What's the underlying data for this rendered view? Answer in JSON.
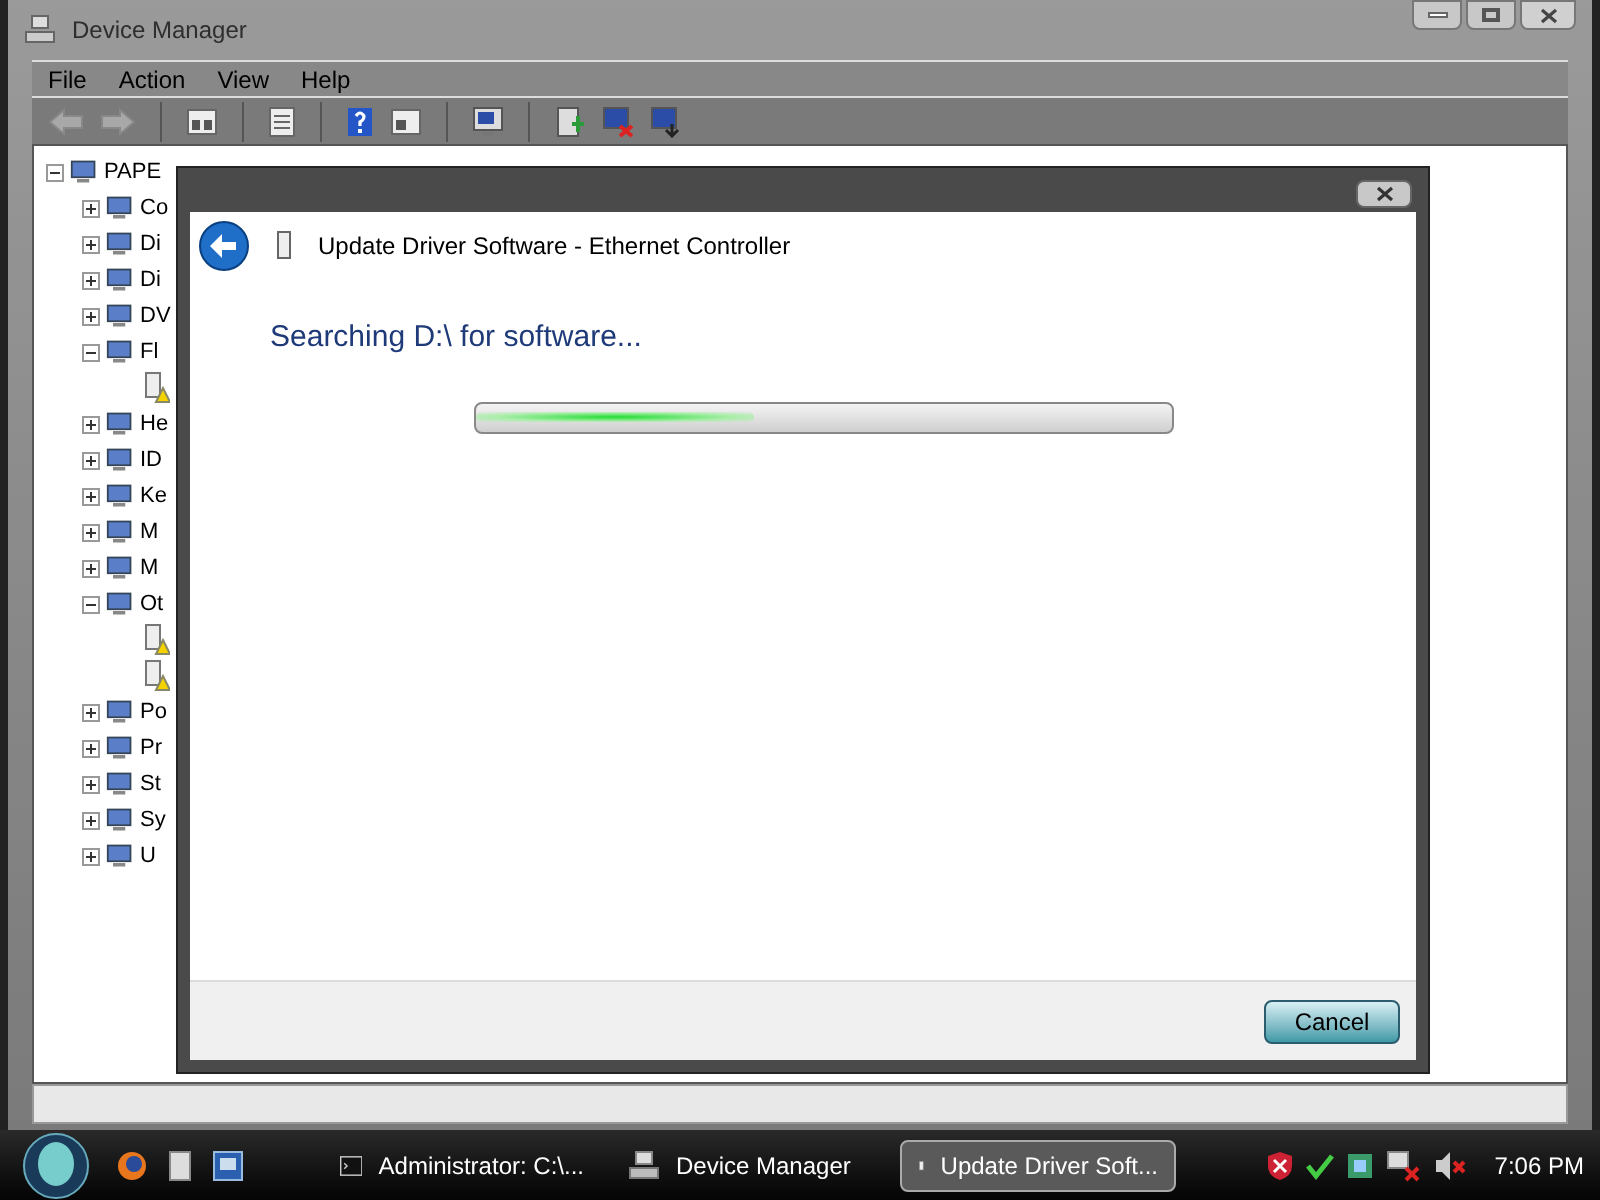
{
  "window": {
    "title": "Device Manager",
    "active": false
  },
  "menu": [
    "File",
    "Action",
    "View",
    "Help"
  ],
  "toolbar": [
    {
      "kind": "back"
    },
    {
      "kind": "forward"
    },
    {
      "kind": "sep"
    },
    {
      "kind": "console"
    },
    {
      "kind": "sep"
    },
    {
      "kind": "properties"
    },
    {
      "kind": "sep"
    },
    {
      "kind": "help"
    },
    {
      "kind": "view"
    },
    {
      "kind": "sep"
    },
    {
      "kind": "scan"
    },
    {
      "kind": "sep"
    },
    {
      "kind": "update"
    },
    {
      "kind": "disable"
    },
    {
      "kind": "uninstall"
    }
  ],
  "tree": {
    "label": "PAPE",
    "expanded": true,
    "children": [
      {
        "label": "Co",
        "expanded": false
      },
      {
        "label": "Di",
        "expanded": false
      },
      {
        "label": "Di",
        "expanded": false
      },
      {
        "label": "DV",
        "expanded": false
      },
      {
        "label": "Fl",
        "expanded": true,
        "children": [
          {
            "warning": true
          }
        ]
      },
      {
        "label": "He",
        "expanded": false
      },
      {
        "label": "ID",
        "expanded": false
      },
      {
        "label": "Ke",
        "expanded": false
      },
      {
        "label": "M",
        "expanded": false
      },
      {
        "label": "M",
        "expanded": false
      },
      {
        "label": "Ot",
        "expanded": true,
        "children": [
          {
            "warning": true
          },
          {
            "warning": true
          }
        ]
      },
      {
        "label": "Po",
        "expanded": false
      },
      {
        "label": "Pr",
        "expanded": false
      },
      {
        "label": "St",
        "expanded": false
      },
      {
        "label": "Sy",
        "expanded": false
      },
      {
        "label": "U",
        "expanded": false
      }
    ]
  },
  "dialog": {
    "title": "Update Driver Software - Ethernet Controller",
    "heading": "Searching D:\\ for software...",
    "progress": {
      "level": 0.4
    },
    "buttons": [
      "Cancel"
    ]
  },
  "taskbar": {
    "items": [
      {
        "label": "Administrator: C:\\...",
        "kind": "console",
        "selected": false
      },
      {
        "label": "Device Manager",
        "kind": "devmgr",
        "selected": false
      },
      {
        "label": "Update Driver Soft...",
        "kind": "driver",
        "selected": true
      }
    ],
    "clock": "7:06 PM"
  }
}
